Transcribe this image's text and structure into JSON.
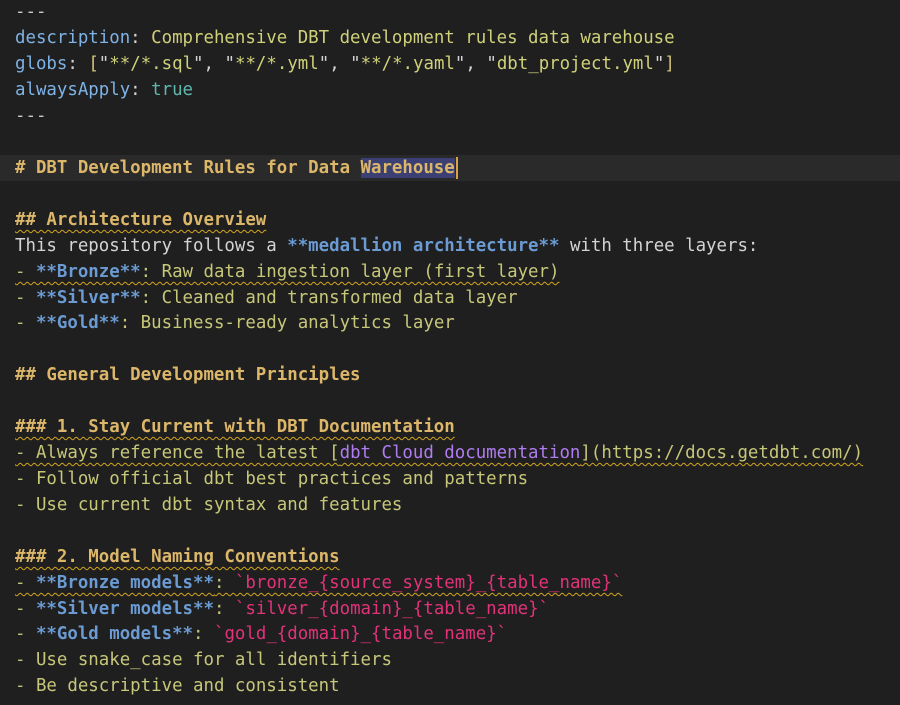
{
  "frontmatter": {
    "dash_open": "---",
    "description_key": "description",
    "description_value": "Comprehensive DBT development rules data warehouse",
    "globs_key": "globs",
    "globs": [
      "**/*.sql",
      "**/*.yml",
      "**/*.yaml",
      "dbt_project.yml"
    ],
    "always_key": "alwaysApply",
    "always_value": "true",
    "dash_close": "---"
  },
  "title": {
    "prefix": "# DBT Development Rules for Data ",
    "selected": "Warehouse"
  },
  "architecture": {
    "heading": "## Architecture Overview",
    "intro_before": "This repository follows a ",
    "intro_bold": "**medallion architecture**",
    "intro_after": " with three layers:",
    "items": [
      {
        "bold": "**Bronze**",
        "rest": ": Raw data ingestion layer (first layer)"
      },
      {
        "bold": "**Silver**",
        "rest": ": Cleaned and transformed data layer"
      },
      {
        "bold": "**Gold**",
        "rest": ": Business-ready analytics layer"
      }
    ]
  },
  "principles": {
    "heading": "## General Development Principles"
  },
  "section1": {
    "heading": "### 1. Stay Current with DBT Documentation",
    "item1_before": "Always reference the latest [",
    "item1_link": "dbt Cloud documentation",
    "item1_after": "](https://docs.getdbt.com/)",
    "item2": "Follow official dbt best practices and patterns",
    "item3": "Use current dbt syntax and features"
  },
  "section2": {
    "heading": "### 2. Model Naming Conventions",
    "items": [
      {
        "bold": "**Bronze models**",
        "sep": ": ",
        "code": "`bronze_{source_system}_{table_name}`"
      },
      {
        "bold": "**Silver models**",
        "sep": ": ",
        "code": "`silver_{domain}_{table_name}`"
      },
      {
        "bold": "**Gold models**",
        "sep": ": ",
        "code": "`gold_{domain}_{table_name}`"
      }
    ],
    "item4": "Use snake_case for all identifiers",
    "item5": "Be descriptive and consistent"
  },
  "bullet_marker": "- "
}
